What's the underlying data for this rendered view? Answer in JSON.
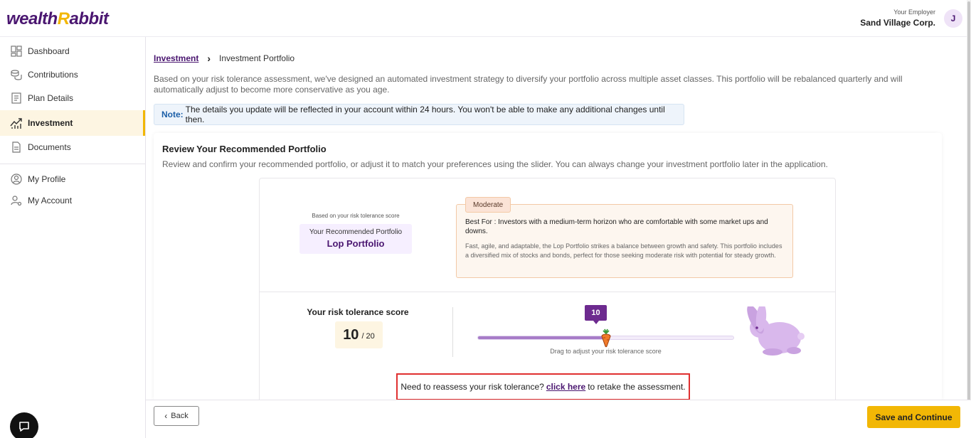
{
  "header": {
    "logo_main": "wealth",
    "logo_accent": "R",
    "logo_tail": "abbit",
    "employer_label": "Your Employer",
    "employer_name": "Sand Village Corp.",
    "avatar_initial": "J"
  },
  "sidebar": {
    "items": [
      {
        "label": "Dashboard",
        "icon": "dashboard-icon"
      },
      {
        "label": "Contributions",
        "icon": "coins-icon"
      },
      {
        "label": "Plan Details",
        "icon": "document-list-icon"
      },
      {
        "label": "Investment",
        "icon": "chart-growth-icon",
        "active": true
      },
      {
        "label": "Documents",
        "icon": "file-icon"
      },
      {
        "label": "My Profile",
        "icon": "user-circle-icon"
      },
      {
        "label": "My Account",
        "icon": "user-gear-icon"
      }
    ]
  },
  "breadcrumb": {
    "parent": "Investment",
    "current": "Investment Portfolio"
  },
  "intro_text": "Based on your risk tolerance assessment, we've designed an automated investment strategy to diversify your portfolio across multiple asset classes. This portfolio will be rebalanced quarterly and will automatically adjust to become more conservative as you age.",
  "note": {
    "label": "Note:",
    "text": "The details you update will be reflected in your account within 24 hours. You won't be able to make any additional changes until then."
  },
  "review": {
    "title": "Review Your Recommended Portfolio",
    "subtitle": "Review and confirm your recommended portfolio, or adjust it to match your preferences using the slider. You can always change your investment portfolio later in the application."
  },
  "portfolio": {
    "based_on": "Based on your risk tolerance score",
    "rec_label": "Your Recommended Portfolio",
    "rec_name": "Lop Portfolio",
    "tag": "Moderate",
    "best_for": "Best For : Investors with a medium-term horizon who are comfortable with some market ups and downs.",
    "description": "Fast, agile, and adaptable, the Lop Portfolio strikes a balance between growth and safety. This portfolio includes a diversified mix of stocks and bonds, perfect for those seeking moderate risk with potential for steady growth."
  },
  "score": {
    "label": "Your risk tolerance score",
    "value": "10",
    "max": "/ 20",
    "slider_value": "10",
    "slider_fraction": 0.5,
    "drag_hint": "Drag to adjust your risk tolerance score"
  },
  "reassess": {
    "prefix": "Need to reassess your risk tolerance?",
    "link": "click here",
    "suffix": "to retake the assessment."
  },
  "footer": {
    "back": "Back",
    "save": "Save and Continue"
  },
  "colors": {
    "brand": "#4a1670",
    "accent": "#f2b705",
    "slider": "#a77cc8"
  }
}
